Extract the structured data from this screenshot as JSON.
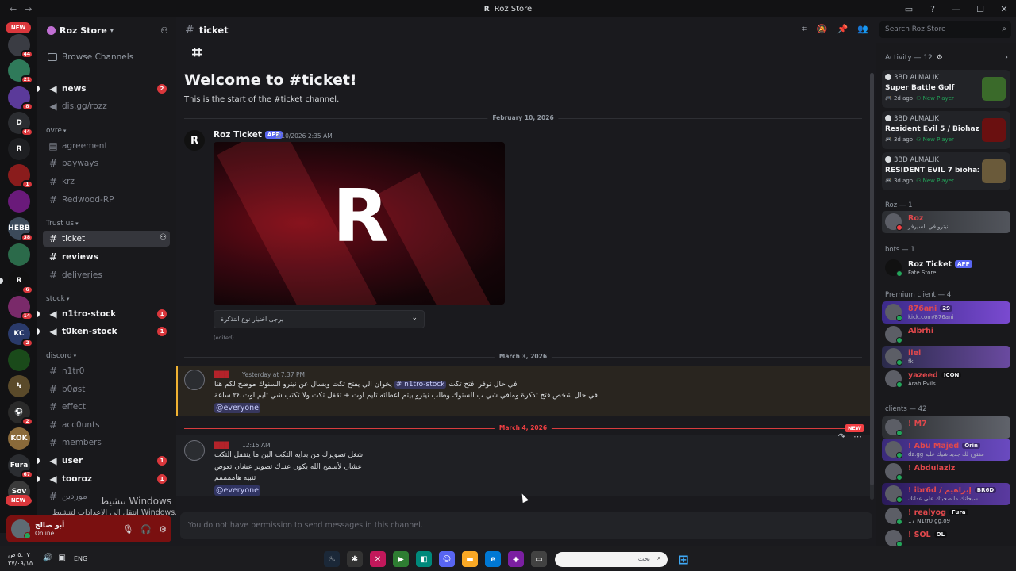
{
  "window": {
    "title": "Roz Store",
    "back": "←",
    "forward": "→",
    "controls": [
      "▭",
      "?",
      "—",
      "☐",
      "✕"
    ]
  },
  "rail": {
    "new_top": "NEW",
    "new_bottom": "NEW",
    "servers": [
      {
        "label": "",
        "badge": "44",
        "color": "#3a3c43"
      },
      {
        "label": "",
        "badge": "21",
        "color": "#2f7a5a"
      },
      {
        "label": "",
        "badge": "8",
        "color": "#5b3a9a"
      },
      {
        "label": "D",
        "badge": "44",
        "color": "#2b2d31"
      },
      {
        "label": "R",
        "badge": "",
        "color": "#1e1f22"
      },
      {
        "label": "",
        "badge": "1",
        "color": "#8a1c1c"
      },
      {
        "label": "",
        "badge": "",
        "color": "#6a1a7a"
      },
      {
        "label": "HEBB",
        "badge": "38",
        "color": "#3c4a5a"
      },
      {
        "label": "",
        "badge": "",
        "color": "#2b6a4a"
      },
      {
        "label": "R",
        "badge": "6",
        "color": "#111111"
      },
      {
        "label": "",
        "badge": "14",
        "color": "#7a2a6a"
      },
      {
        "label": "KC",
        "badge": "2",
        "color": "#2a3a6a"
      },
      {
        "label": "",
        "badge": "",
        "color": "#1a4a1a"
      },
      {
        "label": "Ϟ",
        "badge": "",
        "color": "#5a4a2a"
      },
      {
        "label": "⚽",
        "badge": "2",
        "color": "#2a2a2a"
      },
      {
        "label": "KOK",
        "badge": "",
        "color": "#8a6a3a"
      },
      {
        "label": "Fura",
        "badge": "67",
        "color": "#2b2d31"
      },
      {
        "label": "Sov",
        "badge": "91",
        "color": "#3a3a3a"
      },
      {
        "label": "",
        "badge": "",
        "color": "#1e3a6a"
      }
    ]
  },
  "server": {
    "name": "Roz Store",
    "browse": "Browse Channels"
  },
  "channels": {
    "news": {
      "name": "news",
      "badge": "2"
    },
    "disgg": {
      "name": "dis.gg/rozz"
    },
    "cat_ovre": "ovre",
    "agreement": {
      "name": "agreement"
    },
    "payways": {
      "name": "payways"
    },
    "krz": {
      "name": "krz"
    },
    "redwood": {
      "name": "Redwood-RP"
    },
    "cat_trust": "Trust us",
    "ticket": {
      "name": "ticket"
    },
    "reviews": {
      "name": "reviews"
    },
    "deliveries": {
      "name": "deliveries"
    },
    "cat_stock": "stock",
    "n1tro_stock": {
      "name": "n1tro-stock",
      "badge": "1"
    },
    "t0ken_stock": {
      "name": "t0ken-stock",
      "badge": "1"
    },
    "cat_discord": "discord",
    "n1tr0": {
      "name": "n1tr0"
    },
    "b0st": {
      "name": "b0øst"
    },
    "effect": {
      "name": "effect"
    },
    "accounts": {
      "name": "acc0unts"
    },
    "members": {
      "name": "members"
    },
    "user": {
      "name": "user",
      "badge": "1"
    },
    "tooroz": {
      "name": "tooroz",
      "badge": "1"
    },
    "mwrdyn": {
      "name": "موردين"
    }
  },
  "watermark": {
    "line1": "تنشيط Windows",
    "line2": "انتقل إلى الإعدادات لتنشيط Windows."
  },
  "user_panel": {
    "name": "أبو صالح",
    "status": "Online"
  },
  "header": {
    "channel": "ticket",
    "search_placeholder": "Search Roz Store"
  },
  "welcome": {
    "title": "Welcome to #ticket!",
    "subtitle": "This is the start of the #ticket channel."
  },
  "dates": {
    "d1": "February 10, 2026",
    "d2": "March 3, 2026",
    "d3": "March 4, 2026",
    "new_tag": "NEW"
  },
  "msg1": {
    "author": "Roz Ticket",
    "app_tag": "APP",
    "time": "2/10/2026 2:35 AM",
    "select_placeholder": "يرجى اختيار نوع التذكرة",
    "edited": "(edited)"
  },
  "msg2": {
    "time": "Yesterday at 7:37 PM",
    "line1_before": "يخوان الي يفتح تكت ويسال عن نيترو السنوك موضح لكم هنا",
    "channel_mention": "# n1tro-stock",
    "line1_after": "في حال توفر افتح تكت",
    "line2": "في حال شخص فتح تذكرة ومافي شي ب الستوك وطلب نيترو بيتم اعطائه تايم اوت + تقفل تكت ولا تكتب شي تايم اوت ٢٤ ساعة",
    "mention": "@everyone"
  },
  "msg3": {
    "time": "12:15 AM",
    "line1": "شغل تصويرك من بدايه التكت الين ما يتقفل التكت",
    "line2": "عشان لأسمح الله يكون عندك تصوير عشان تعوض",
    "line3": "تنبيه هاممممم",
    "mention": "@everyone"
  },
  "composer": {
    "placeholder": "You do not have permission to send messages in this channel."
  },
  "activity": {
    "header": "Activity — 12",
    "cards": [
      {
        "user": "3BD ALMALIK",
        "game": "Super Battle Golf",
        "ago": "2d ago",
        "tag": "New Player",
        "thumb": "#3a6a2a"
      },
      {
        "user": "3BD ALMALIK",
        "game": "Resident Evil 5 / Biohazard 5",
        "ago": "3d ago",
        "tag": "New Player",
        "thumb": "#6a1010"
      },
      {
        "user": "3BD ALMALIK",
        "game": "RESIDENT EVIL 7 biohazar...",
        "ago": "3d ago",
        "tag": "New Player",
        "thumb": "#6a5a3a"
      }
    ]
  },
  "members": {
    "roz_header": "Roz — 1",
    "roz_member": {
      "name": "Roz",
      "sub": "نيترو في السيرفر"
    },
    "bots_header": "bots — 1",
    "bot": {
      "name": "Roz Ticket",
      "tag": "APP",
      "sub": "Fate Store"
    },
    "premium_header": "Premium client — 4",
    "premium": [
      {
        "name": "876ani",
        "tag": "29",
        "sub": "kick.com/876ani"
      },
      {
        "name": "Albrhi",
        "tag": "",
        "sub": ""
      },
      {
        "name": "ilel",
        "tag": "",
        "sub": "fk"
      },
      {
        "name": "yazeed",
        "tag": "ICON",
        "sub": "Arab Evils"
      }
    ],
    "clients_header": "clients — 42",
    "clients": [
      {
        "name": "! M7",
        "tag": "",
        "sub": ""
      },
      {
        "name": "! Abu Majed",
        "tag": "Orin",
        "sub": "dz.gg مفتوح لك جديد شيك عليه"
      },
      {
        "name": "! Abdulaziz",
        "tag": "",
        "sub": ""
      },
      {
        "name": "! ibr6d / إبراهيم",
        "tag": "BR6D",
        "sub": "سبحانك ما صحبتك على عدانك"
      },
      {
        "name": "! realyog",
        "tag": "Fura",
        "sub": "17 N1tr0 gg.o9"
      },
      {
        "name": "! SOL",
        "tag": "OL",
        "sub": ""
      }
    ]
  },
  "taskbar": {
    "time": "٥:٠٧ ص",
    "date": "٢٧/٠٩/١٥",
    "lang": "ENG",
    "search_placeholder": "بحث"
  }
}
